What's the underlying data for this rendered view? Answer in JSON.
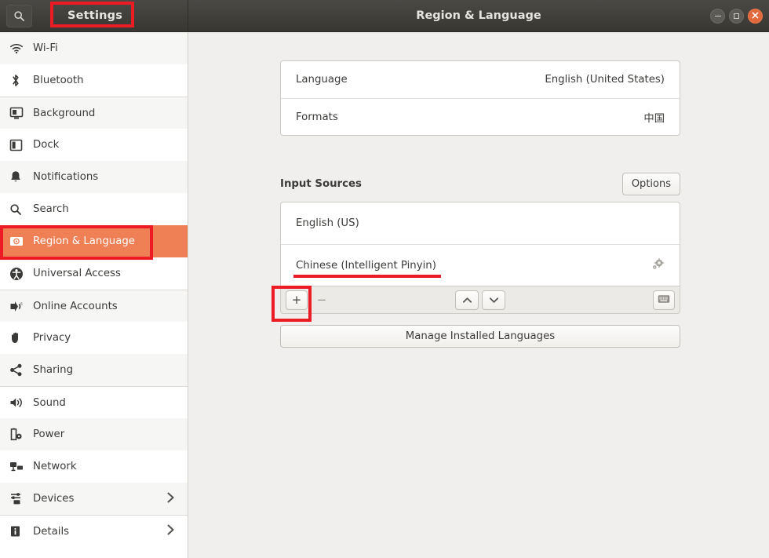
{
  "window": {
    "app_title": "Settings",
    "page_title": "Region & Language",
    "search_icon": "search-icon",
    "controls": {
      "minimize": "minimize-icon",
      "maximize": "maximize-icon",
      "close": "close-icon"
    }
  },
  "sidebar": {
    "items": [
      {
        "label": "Wi-Fi",
        "icon": "wifi-icon",
        "has_chevron": false
      },
      {
        "label": "Bluetooth",
        "icon": "bluetooth-icon",
        "has_chevron": false
      },
      {
        "label": "Background",
        "icon": "background-icon",
        "has_chevron": false
      },
      {
        "label": "Dock",
        "icon": "dock-icon",
        "has_chevron": false
      },
      {
        "label": "Notifications",
        "icon": "bell-icon",
        "has_chevron": false
      },
      {
        "label": "Search",
        "icon": "search-icon",
        "has_chevron": false
      },
      {
        "label": "Region & Language",
        "icon": "region-language-icon",
        "has_chevron": false
      },
      {
        "label": "Universal Access",
        "icon": "accessibility-icon",
        "has_chevron": false
      },
      {
        "label": "Online Accounts",
        "icon": "online-accounts-icon",
        "has_chevron": false
      },
      {
        "label": "Privacy",
        "icon": "privacy-hand-icon",
        "has_chevron": false
      },
      {
        "label": "Sharing",
        "icon": "sharing-icon",
        "has_chevron": false
      },
      {
        "label": "Sound",
        "icon": "speaker-icon",
        "has_chevron": false
      },
      {
        "label": "Power",
        "icon": "battery-icon",
        "has_chevron": false
      },
      {
        "label": "Network",
        "icon": "network-icon",
        "has_chevron": false
      },
      {
        "label": "Devices",
        "icon": "devices-icon",
        "has_chevron": true
      },
      {
        "label": "Details",
        "icon": "info-icon",
        "has_chevron": true
      }
    ],
    "selected_index": 6,
    "selected_color": "#ef8055"
  },
  "main": {
    "language_row": {
      "label": "Language",
      "value": "English (United States)"
    },
    "formats_row": {
      "label": "Formats",
      "value": "中国"
    },
    "input_sources": {
      "title": "Input Sources",
      "options_label": "Options",
      "sources": [
        {
          "label": "English (US)",
          "has_gear": false
        },
        {
          "label": "Chinese (Intelligent Pinyin)",
          "has_gear": true,
          "gear_icon": "gear-icon"
        }
      ],
      "toolbar": {
        "add_label": "+",
        "remove_label": "−",
        "move_up_icon": "chevron-up-icon",
        "move_down_icon": "chevron-down-icon",
        "keyboard_icon": "keyboard-icon"
      }
    },
    "manage_languages_label": "Manage Installed Languages"
  },
  "annotations": {
    "color": "#ed1c24",
    "highlight_settings_title": true,
    "highlight_region_language_item": true,
    "underline_chinese_source": true,
    "highlight_add_button": true
  }
}
